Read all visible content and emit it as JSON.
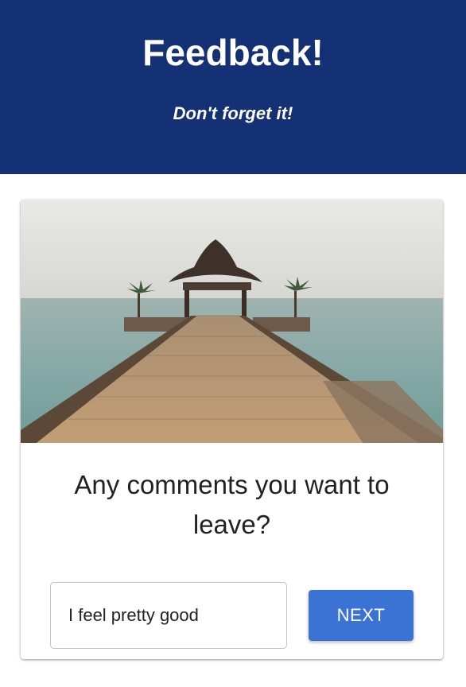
{
  "header": {
    "title": "Feedback!",
    "subtitle": "Don't forget it!",
    "background_color": "#133174"
  },
  "card": {
    "question": "Any comments you want to leave?",
    "comment_input": {
      "value": "I feel pretty good"
    },
    "next_button": {
      "label": "NEXT",
      "color": "#3a73d3"
    }
  }
}
